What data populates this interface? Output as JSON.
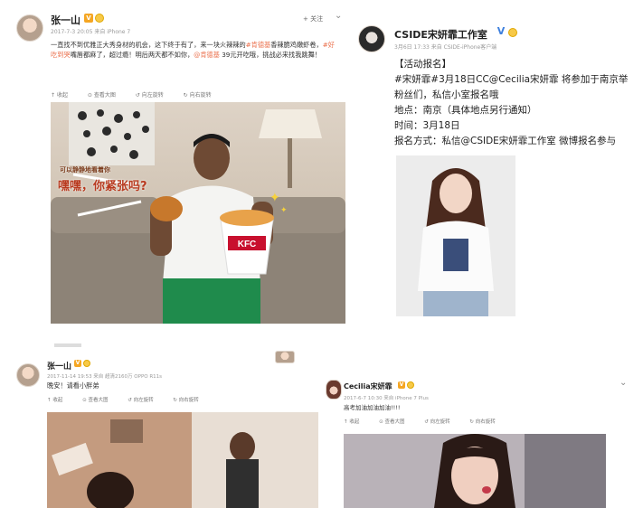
{
  "card1": {
    "username": "张一山",
    "meta": "2017-7-3 20:05 来自 iPhone 7",
    "follow_label": "+ 关注",
    "text_parts": [
      "一直找不到优雅正大秀身材的机会，这下终于有了，来一块火辣辣的",
      "#肯德基",
      "香辣脆鸡嫩虾卷，",
      "#好吃到哭",
      "嘴唇都麻了，超过瘾！明后两天都不如你，",
      "@肯德基",
      " 39元开吃哦，挑战必来找我跳舞！"
    ],
    "actions": [
      "收起",
      "查看大图",
      "向左旋转",
      "向右旋转"
    ],
    "overlay_small": "可以静静地看着你",
    "overlay_big": "嘿嘿，你紧张吗?",
    "bucket_logo": "KFC"
  },
  "card2": {
    "username": "CSIDE宋妍霏工作室",
    "meta": "3月6日 17:33 来自 CSIDE-iPhone客户端",
    "lines": [
      "【活动报名】",
      "#宋妍霏#3月18日CC@Cecilia宋妍霏 将参加于南京举",
      "粉丝们，私信小室报名哦",
      "地点：南京（具体地点另行通知）",
      "时间：3月18日",
      "报名方式：私信@CSIDE宋妍霏工作室 微博报名参与"
    ]
  },
  "card3": {
    "username": "张一山",
    "meta": "2017-11-14 19:53 来自 超清2160万 OPPO R11s",
    "text": "晚安！请看小胖弟",
    "actions": [
      "收起",
      "查看大图",
      "向左旋转",
      "向右旋转"
    ]
  },
  "card4": {
    "username": "Cecilia宋妍霏",
    "meta": "2017-6-7 10:30 来自 iPhone 7 Plus",
    "text": "高考加油加油加油!!!!",
    "actions": [
      "收起",
      "查看大图",
      "向左旋转",
      "向右旋转"
    ]
  },
  "colors": {
    "accent": "#eb7350",
    "verified_blue": "#3d7fdd",
    "badge_orange": "#f5a623"
  }
}
